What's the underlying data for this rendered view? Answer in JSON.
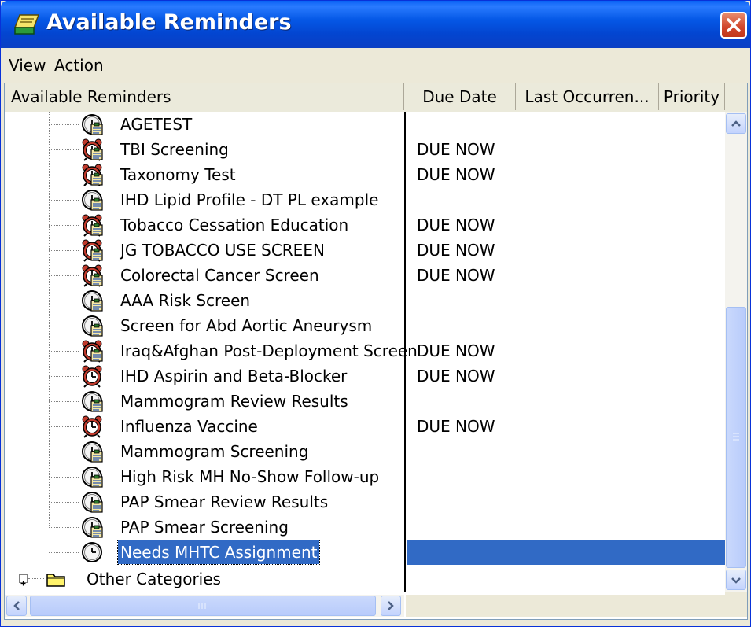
{
  "window": {
    "title": "Available Reminders",
    "title_icon": "reminder-notebook-icon",
    "close_icon": "close-icon"
  },
  "menu": {
    "items": [
      {
        "label": "View"
      },
      {
        "label": "Action"
      }
    ]
  },
  "columns": {
    "name": "Available Reminders",
    "due_date": "Due Date",
    "last_occurrence": "Last Occurren...",
    "priority": "Priority"
  },
  "reminders": [
    {
      "name": "AGETEST",
      "due": "",
      "icon": "clock-clipboard-icon"
    },
    {
      "name": "TBI Screening",
      "due": "DUE NOW",
      "icon": "alarm-clock-clipboard-icon"
    },
    {
      "name": "Taxonomy Test",
      "due": "DUE NOW",
      "icon": "alarm-clock-clipboard-icon"
    },
    {
      "name": "IHD Lipid Profile - DT PL example",
      "due": "",
      "icon": "clock-clipboard-icon"
    },
    {
      "name": "Tobacco Cessation Education",
      "due": "DUE NOW",
      "icon": "alarm-clock-clipboard-icon"
    },
    {
      "name": "JG TOBACCO USE SCREEN",
      "due": "DUE NOW",
      "icon": "alarm-clock-clipboard-icon"
    },
    {
      "name": "Colorectal Cancer Screen",
      "due": "DUE NOW",
      "icon": "alarm-clock-clipboard-icon"
    },
    {
      "name": "AAA Risk Screen",
      "due": "",
      "icon": "clock-clipboard-icon"
    },
    {
      "name": "Screen for Abd Aortic Aneurysm",
      "due": "",
      "icon": "clock-clipboard-icon"
    },
    {
      "name": "Iraq&Afghan Post-Deployment Screen",
      "due": "DUE NOW",
      "icon": "alarm-clock-clipboard-icon"
    },
    {
      "name": "IHD Aspirin and Beta-Blocker",
      "due": "DUE NOW",
      "icon": "alarm-clock-icon"
    },
    {
      "name": "Mammogram Review Results",
      "due": "",
      "icon": "clock-clipboard-icon"
    },
    {
      "name": "Influenza Vaccine",
      "due": "DUE NOW",
      "icon": "alarm-clock-icon"
    },
    {
      "name": "Mammogram Screening",
      "due": "",
      "icon": "clock-clipboard-icon"
    },
    {
      "name": "High Risk MH No-Show Follow-up",
      "due": "",
      "icon": "clock-clipboard-icon"
    },
    {
      "name": "PAP Smear Review Results",
      "due": "",
      "icon": "clock-clipboard-icon"
    },
    {
      "name": "PAP Smear Screening",
      "due": "",
      "icon": "clock-clipboard-icon"
    },
    {
      "name": "Needs MHTC Assignment",
      "due": "",
      "icon": "clock-icon",
      "selected": true
    }
  ],
  "other_categories": {
    "label": "Other Categories",
    "icon": "folder-icon",
    "expand_symbol": "+"
  },
  "scrollbar": {
    "up_icon": "scroll-up-arrow-icon",
    "down_icon": "scroll-down-arrow-icon",
    "left_icon": "scroll-left-arrow-icon",
    "right_icon": "scroll-right-arrow-icon"
  },
  "colors": {
    "selection": "#316ac5",
    "titlebar": "#0558e6",
    "close": "#d0452a"
  }
}
